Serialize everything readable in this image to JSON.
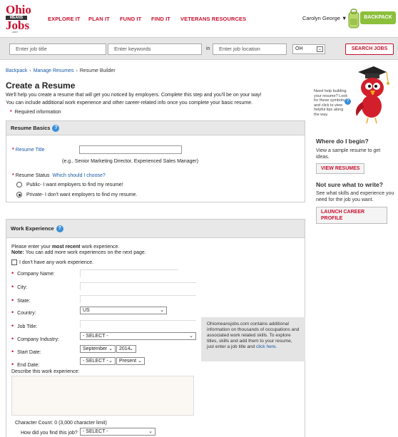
{
  "header": {
    "logo": {
      "line1": "Ohio",
      "line2": "MEANS",
      "line3": "Jobs",
      "line4": ".com"
    },
    "nav": [
      "EXPLORE IT",
      "PLAN IT",
      "FUND IT",
      "FIND IT",
      "VETERANS RESOURCES"
    ],
    "user_name": "Carolyn George ▼",
    "backpack_label": "BACKPACK"
  },
  "search": {
    "job_title_placeholder": "Enter job title",
    "keywords_placeholder": "Enter keywords",
    "in_label": "in",
    "location_placeholder": "Enter job location",
    "state_value": "OH",
    "search_button": "SEARCH JOBS"
  },
  "breadcrumb": [
    "Backpack",
    "Manage Resumes",
    "Resume Builder"
  ],
  "page": {
    "title": "Create a Resume",
    "intro1": "We'll help you create a resume that will get you noticed by employers. Complete this step and you'll be on your way!",
    "intro2": "You can include additional work experience and other career-related info once you complete your basic resume.",
    "required_note": "Required information"
  },
  "resume_basics": {
    "heading": "Resume Basics",
    "title_label": "Resume Title",
    "title_example": "(e.g., Senior Marketing Director, Experienced Sales Manager)",
    "status_label": "Resume Status",
    "status_link": "Which should I choose?",
    "public_option": "Public- I want employers to find my resume!",
    "private_option": "Private- I don't want employers to find my resume.",
    "selected": "private"
  },
  "work_experience": {
    "heading": "Work Experience",
    "intro_pre": "Please enter your ",
    "intro_bold": "most recent",
    "intro_post": " work experience.",
    "note_bold": "Note:",
    "note_text": " You can add more work experiences on the next page.",
    "no_experience": "I don't have any work experience.",
    "fields": {
      "company": "Company Name:",
      "city": "City:",
      "state": "State:",
      "country": "Country:",
      "job_title": "Job Title:",
      "industry": "Company Industry:",
      "start_date": "Start Date:",
      "end_date": "End Date:"
    },
    "country_value": "US",
    "industry_value": "- SELECT -",
    "start_month": "September",
    "start_year": "2014",
    "end_month": "- SELECT -",
    "end_year": "Present",
    "describe_label": "Describe this work experience:",
    "char_count": "Character Count:  0 (3,000 character limit)",
    "found_label": "How did you find this job?",
    "found_value": "- SELECT -",
    "tip_text": "Ohiomeansjobs.com contains additional information on thousands of occupations and associated work related skills. To explore titles, skills and add them to your resume, just enter a job title and ",
    "tip_link": "click here."
  },
  "sidebar": {
    "help_tip": "Need help building your resume? Look for these symbols and click to view helpful tips along the way.",
    "where_heading": "Where do I begin?",
    "where_text": "View a sample resume to get ideas.",
    "view_resumes_button": "VIEW RESUMES",
    "not_sure_heading": "Not sure what to write?",
    "not_sure_text": "See what skills and experience you need for the job you want.",
    "launch_line1": "LAUNCH CAREER",
    "launch_line2": "PROFILE"
  },
  "colors": {
    "brand_red": "#c8102e",
    "link_blue": "#1a5aa8",
    "backpack_green": "#8bbf3c",
    "help_blue": "#3a8fd8"
  }
}
